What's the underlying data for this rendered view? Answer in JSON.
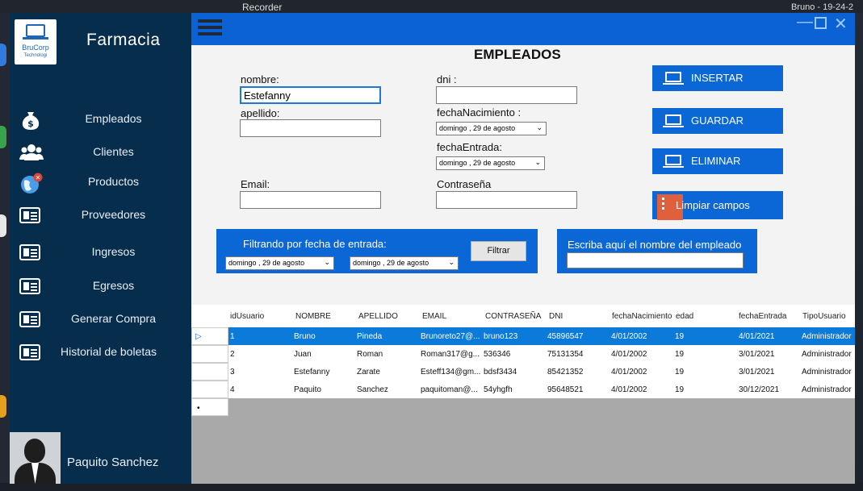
{
  "desktop": {
    "recorder_label": "Recorder",
    "right_label": "Bruno - 19-24-2"
  },
  "app": {
    "brand_name": "BruCorp",
    "brand_sub": "Technologi",
    "title": "Farmacia"
  },
  "sidebar": {
    "items": [
      {
        "label": "Empleados",
        "icon": "money-bag-icon"
      },
      {
        "label": "Clientes",
        "icon": "users-icon"
      },
      {
        "label": "Productos",
        "icon": "globe-icon"
      },
      {
        "label": "Proveedores",
        "icon": "id-card-icon"
      },
      {
        "label": "Ingresos",
        "icon": "id-card-icon"
      },
      {
        "label": "Egresos",
        "icon": "id-card-icon"
      },
      {
        "label": "Generar Compra",
        "icon": "id-card-icon"
      },
      {
        "label": "Historial de boletas",
        "icon": "id-card-icon"
      }
    ],
    "user_name": "Paquito Sanchez"
  },
  "form": {
    "title": "EMPLEADOS",
    "nombre_label": "nombre:",
    "nombre_value": "Estefanny",
    "apellido_label": "apellido:",
    "apellido_value": "",
    "email_label": "Email:",
    "email_value": "",
    "dni_label": "dni :",
    "dni_value": "",
    "fecha_nacimiento_label": "fechaNacimiento :",
    "fecha_nacimiento_value": "domingo , 29 de     agosto",
    "fecha_entrada_label": "fechaEntrada:",
    "fecha_entrada_value": "domingo , 29 de     agosto",
    "contrasena_label": "Contraseña",
    "contrasena_value": ""
  },
  "actions": {
    "insertar": "INSERTAR",
    "guardar": "GUARDAR",
    "eliminar": "ELIMINAR",
    "limpiar": "Limpiar campos"
  },
  "filter": {
    "label": "Filtrando por fecha de entrada:",
    "from_value": "domingo , 29 de     agosto",
    "to_value": "domingo , 29 de     agosto",
    "button": "Filtrar"
  },
  "search": {
    "label": "Escriba aquí el nombre del empleado",
    "value": ""
  },
  "table": {
    "columns": [
      "idUsuario",
      "NOMBRE",
      "APELLIDO",
      "EMAIL",
      "CONTRASEÑA",
      "DNI",
      "fechaNacimiento",
      "edad",
      "fechaEntrada",
      "TipoUsuario"
    ],
    "rows": [
      [
        "1",
        "Bruno",
        "Pineda",
        "Brunoreto27@...",
        "bruno123",
        "45896547",
        "4/01/2002",
        "19",
        "4/01/2021",
        "Administrador"
      ],
      [
        "2",
        "Juan",
        "Roman",
        "Roman317@g...",
        "536346",
        "75131354",
        "4/01/2002",
        "19",
        "3/01/2021",
        "Administrador"
      ],
      [
        "3",
        "Estefanny",
        "Zarate",
        "Esteff134@gm...",
        "bdsf3434",
        "85421352",
        "4/01/2002",
        "19",
        "3/01/2021",
        "Administrador"
      ],
      [
        "4",
        "Paquito",
        "Sanchez",
        "paquitoman@...",
        "54yhgfh",
        "95648521",
        "4/01/2002",
        "19",
        "30/12/2021",
        "Administrador"
      ]
    ],
    "selected_row_marker": "▷",
    "new_row_marker": "•"
  },
  "colors": {
    "sidebar": "#072d4c",
    "accent": "#0b66d6",
    "selected_row": "#0b7ad8",
    "clear_icon": "#e0603d"
  }
}
